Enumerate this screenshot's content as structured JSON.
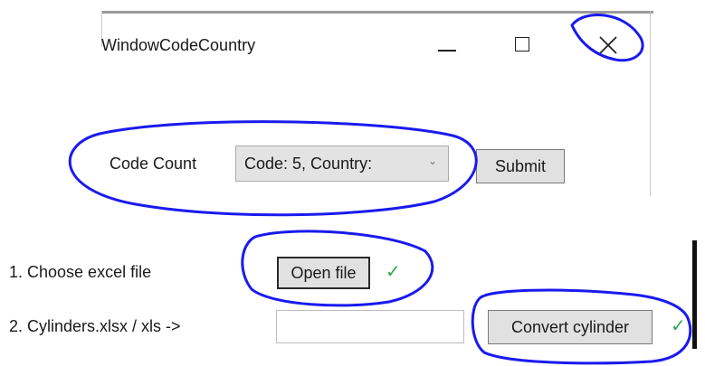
{
  "window": {
    "title": "WindowCodeCountry"
  },
  "form": {
    "code_count_label": "Code Count",
    "dropdown_value": "Code: 5, Country:",
    "submit_label": "Submit"
  },
  "steps": [
    {
      "label": "1. Choose excel file",
      "button_label": "Open file",
      "status": "✓"
    },
    {
      "label": "2. Cylinders.xlsx / xls ->",
      "input_value": "",
      "button_label": "Convert cylinder",
      "status": "✓"
    }
  ],
  "colors": {
    "annotation": "#1a1aee",
    "check": "#2fa84f"
  },
  "icons": {
    "minimize": "minimize-icon",
    "maximize": "maximize-icon",
    "close": "close-icon",
    "dropdown": "chevron-down-icon",
    "check": "checkmark-icon"
  }
}
